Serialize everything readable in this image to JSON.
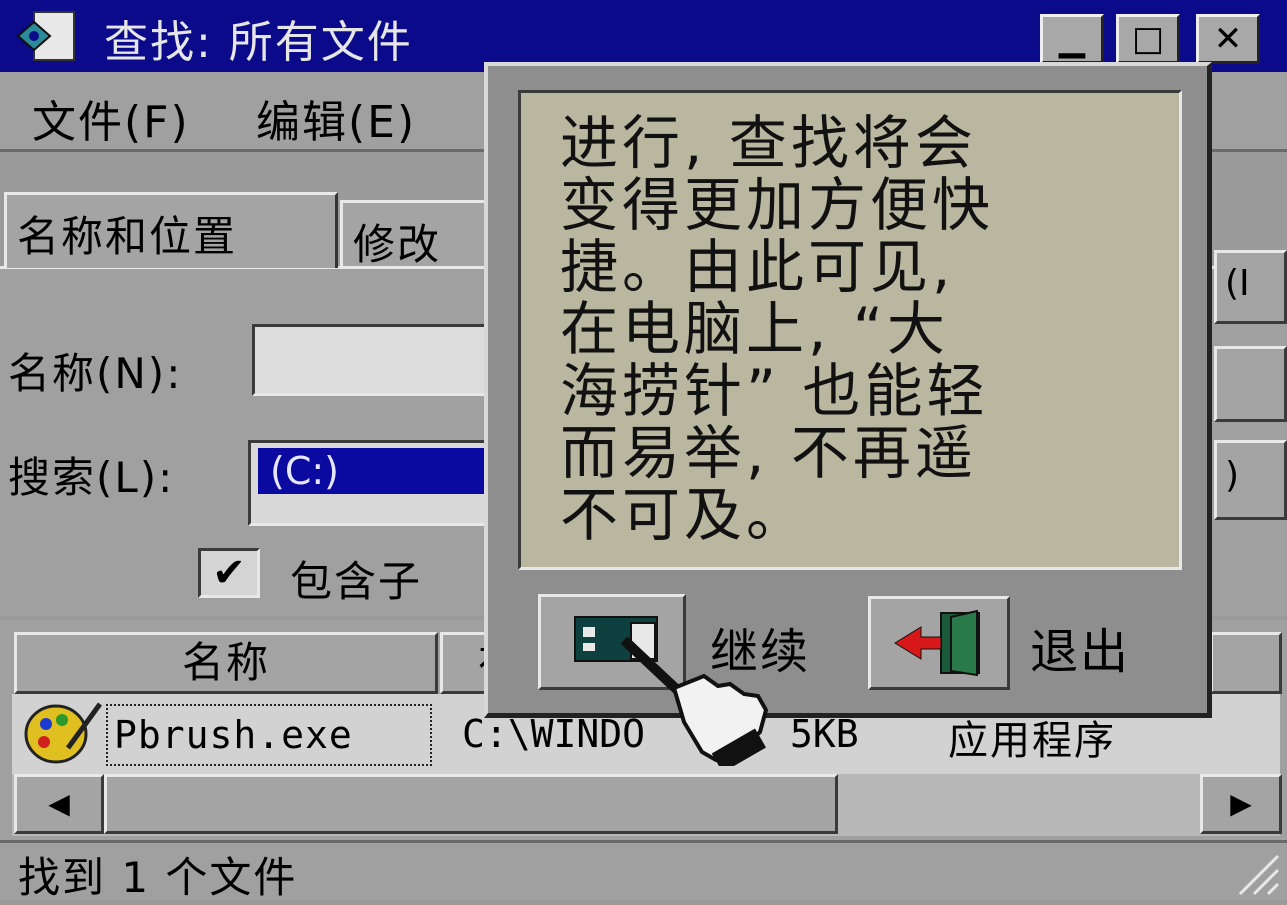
{
  "window": {
    "title": "查找: 所有文件",
    "minimize_glyph": "▁",
    "maximize_glyph": "□",
    "close_glyph": "✕"
  },
  "menu": [
    {
      "label": "文件(F)"
    },
    {
      "label": "编辑(E)"
    }
  ],
  "tabs": [
    {
      "label": "名称和位置"
    },
    {
      "label": "修改"
    }
  ],
  "form": {
    "name_label": "名称(N):",
    "name_value": "",
    "search_label": "搜索(L):",
    "search_value": "(C:)",
    "include_subfolders_label": "包含子",
    "include_subfolders_checked": true,
    "checkmark": "✔",
    "side_button_1_fragment": "(I",
    "side_button_3_fragment": ")"
  },
  "results": {
    "columns": [
      "名称",
      "在"
    ],
    "rows": [
      {
        "name": "Pbrush.exe",
        "path": "C:\\WINDO",
        "size": "5KB",
        "type": "应用程序"
      }
    ]
  },
  "scroll": {
    "left_arrow": "◀",
    "right_arrow": "▶"
  },
  "status": {
    "text": "找到 1 个文件"
  },
  "popup": {
    "lines": [
      "进行, 查找将会",
      "变得更加方便快",
      "捷。由此可见,",
      "在电脑上, “大",
      "海捞针” 也能轻",
      "而易举, 不再遥",
      "不可及。"
    ],
    "continue_label": "继续",
    "exit_label": "退出"
  },
  "colors": {
    "titlebar": "#0a0a8a",
    "window_bg": "#a0a0a0",
    "popup_text_bg": "#b9b7a0",
    "selection": "#0a0aa0"
  }
}
